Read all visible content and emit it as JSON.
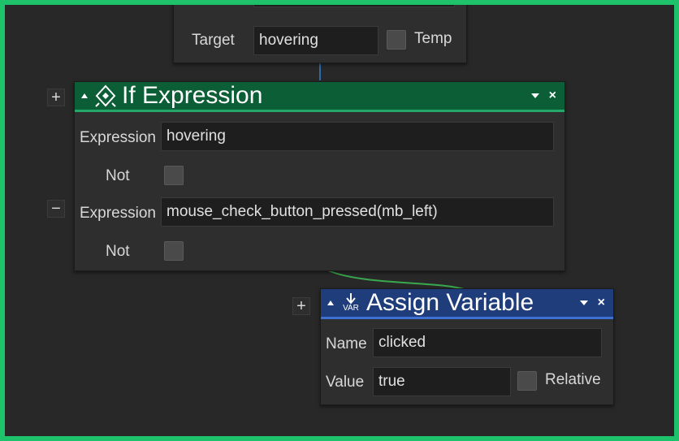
{
  "top_node": {
    "target_label": "Target",
    "target_value": "hovering",
    "temp_label": "Temp"
  },
  "if_node": {
    "title": "If Expression",
    "icon": "if-expression-icon",
    "header_color": "#0b5e35",
    "conditions": [
      {
        "expression_label": "Expression",
        "expression_value": "hovering",
        "not_label": "Not"
      },
      {
        "expression_label": "Expression",
        "expression_value": "mouse_check_button_pressed(mb_left)",
        "not_label": "Not"
      }
    ],
    "add_button": "+",
    "remove_button": "−"
  },
  "assign_node": {
    "title": "Assign Variable",
    "icon": "var-icon",
    "icon_text": "VAR",
    "header_color": "#1e3d7a",
    "name_label": "Name",
    "name_value": "clicked",
    "value_label": "Value",
    "value_value": "true",
    "relative_label": "Relative",
    "add_button": "+"
  }
}
